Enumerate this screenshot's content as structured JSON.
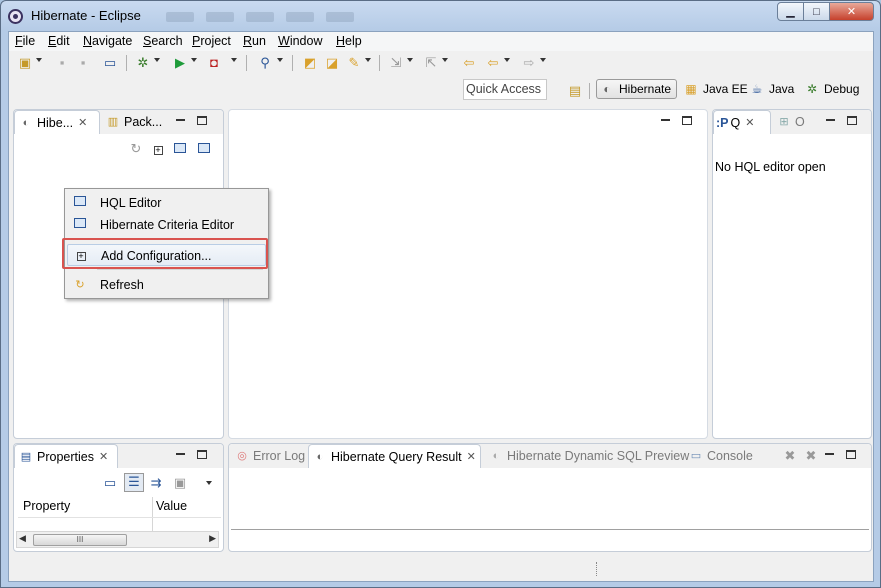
{
  "window": {
    "title": "Hibernate - Eclipse",
    "buttons": {
      "minimize": "▁",
      "maximize": "□",
      "close": "✕"
    }
  },
  "menubar": {
    "items": [
      {
        "label": "File",
        "mnemonic": "F",
        "rest": "ile"
      },
      {
        "label": "Edit",
        "mnemonic": "E",
        "rest": "dit"
      },
      {
        "label": "Navigate",
        "mnemonic": "N",
        "rest": "avigate"
      },
      {
        "label": "Search",
        "mnemonic": "S",
        "rest": "earch"
      },
      {
        "label": "Project",
        "mnemonic": "P",
        "rest": "roject"
      },
      {
        "label": "Run",
        "mnemonic": "R",
        "rest": "un"
      },
      {
        "label": "Window",
        "mnemonic": "W",
        "rest": "indow"
      },
      {
        "label": "Help",
        "mnemonic": "H",
        "rest": "elp"
      }
    ]
  },
  "perspective_bar": {
    "quick_access_placeholder": "Quick Access",
    "perspectives": [
      {
        "label": "Hibernate",
        "icon": "hibernate-icon",
        "active": true
      },
      {
        "label": "Java EE",
        "icon": "java-ee-icon",
        "active": false
      },
      {
        "label": "Java",
        "icon": "java-icon",
        "active": false
      },
      {
        "label": "Debug",
        "icon": "debug-icon",
        "active": false
      }
    ]
  },
  "left_panel": {
    "tabs": [
      {
        "label": "Hibe...",
        "icon": "hibernate-icon",
        "active": true
      },
      {
        "label": "Pack...",
        "icon": "package-explorer-icon",
        "active": false
      }
    ]
  },
  "context_menu": {
    "items": [
      {
        "label": "HQL Editor",
        "icon": "hql-editor-icon"
      },
      {
        "label": "Hibernate Criteria Editor",
        "icon": "criteria-editor-icon"
      },
      {
        "label": "Add Configuration...",
        "icon": "add-config-icon",
        "highlighted": true
      },
      {
        "label": "Refresh",
        "icon": "refresh-icon"
      }
    ]
  },
  "right_panel": {
    "tabs": [
      {
        "label": "Q",
        "prefix": ":P",
        "active": true
      },
      {
        "label": "O",
        "active": false
      }
    ],
    "message": "No HQL editor open"
  },
  "properties_panel": {
    "tab_label": "Properties",
    "columns": [
      "Property",
      "Value"
    ],
    "scroll_grip": "III"
  },
  "bottom_panel": {
    "tabs": [
      {
        "label": "Error Log",
        "active": false
      },
      {
        "label": "Hibernate Query Result",
        "active": true
      },
      {
        "label": "Hibernate Dynamic SQL Preview",
        "active": false
      },
      {
        "label": "Console",
        "active": false
      }
    ]
  },
  "colors": {
    "highlight_border": "#d9534f",
    "window_frame": "#b5cbe6",
    "close_button": "#c6412c"
  }
}
